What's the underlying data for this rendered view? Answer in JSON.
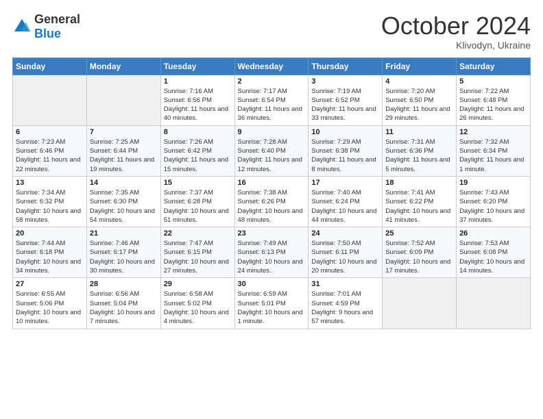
{
  "header": {
    "logo_general": "General",
    "logo_blue": "Blue",
    "month_title": "October 2024",
    "subtitle": "Klivodyn, Ukraine"
  },
  "weekdays": [
    "Sunday",
    "Monday",
    "Tuesday",
    "Wednesday",
    "Thursday",
    "Friday",
    "Saturday"
  ],
  "weeks": [
    [
      {
        "day": "",
        "sunrise": "",
        "sunset": "",
        "daylight": ""
      },
      {
        "day": "",
        "sunrise": "",
        "sunset": "",
        "daylight": ""
      },
      {
        "day": "1",
        "sunrise": "Sunrise: 7:16 AM",
        "sunset": "Sunset: 6:56 PM",
        "daylight": "Daylight: 11 hours and 40 minutes."
      },
      {
        "day": "2",
        "sunrise": "Sunrise: 7:17 AM",
        "sunset": "Sunset: 6:54 PM",
        "daylight": "Daylight: 11 hours and 36 minutes."
      },
      {
        "day": "3",
        "sunrise": "Sunrise: 7:19 AM",
        "sunset": "Sunset: 6:52 PM",
        "daylight": "Daylight: 11 hours and 33 minutes."
      },
      {
        "day": "4",
        "sunrise": "Sunrise: 7:20 AM",
        "sunset": "Sunset: 6:50 PM",
        "daylight": "Daylight: 11 hours and 29 minutes."
      },
      {
        "day": "5",
        "sunrise": "Sunrise: 7:22 AM",
        "sunset": "Sunset: 6:48 PM",
        "daylight": "Daylight: 11 hours and 26 minutes."
      }
    ],
    [
      {
        "day": "6",
        "sunrise": "Sunrise: 7:23 AM",
        "sunset": "Sunset: 6:46 PM",
        "daylight": "Daylight: 11 hours and 22 minutes."
      },
      {
        "day": "7",
        "sunrise": "Sunrise: 7:25 AM",
        "sunset": "Sunset: 6:44 PM",
        "daylight": "Daylight: 11 hours and 19 minutes."
      },
      {
        "day": "8",
        "sunrise": "Sunrise: 7:26 AM",
        "sunset": "Sunset: 6:42 PM",
        "daylight": "Daylight: 11 hours and 15 minutes."
      },
      {
        "day": "9",
        "sunrise": "Sunrise: 7:28 AM",
        "sunset": "Sunset: 6:40 PM",
        "daylight": "Daylight: 11 hours and 12 minutes."
      },
      {
        "day": "10",
        "sunrise": "Sunrise: 7:29 AM",
        "sunset": "Sunset: 6:38 PM",
        "daylight": "Daylight: 11 hours and 8 minutes."
      },
      {
        "day": "11",
        "sunrise": "Sunrise: 7:31 AM",
        "sunset": "Sunset: 6:36 PM",
        "daylight": "Daylight: 11 hours and 5 minutes."
      },
      {
        "day": "12",
        "sunrise": "Sunrise: 7:32 AM",
        "sunset": "Sunset: 6:34 PM",
        "daylight": "Daylight: 11 hours and 1 minute."
      }
    ],
    [
      {
        "day": "13",
        "sunrise": "Sunrise: 7:34 AM",
        "sunset": "Sunset: 6:32 PM",
        "daylight": "Daylight: 10 hours and 58 minutes."
      },
      {
        "day": "14",
        "sunrise": "Sunrise: 7:35 AM",
        "sunset": "Sunset: 6:30 PM",
        "daylight": "Daylight: 10 hours and 54 minutes."
      },
      {
        "day": "15",
        "sunrise": "Sunrise: 7:37 AM",
        "sunset": "Sunset: 6:28 PM",
        "daylight": "Daylight: 10 hours and 51 minutes."
      },
      {
        "day": "16",
        "sunrise": "Sunrise: 7:38 AM",
        "sunset": "Sunset: 6:26 PM",
        "daylight": "Daylight: 10 hours and 48 minutes."
      },
      {
        "day": "17",
        "sunrise": "Sunrise: 7:40 AM",
        "sunset": "Sunset: 6:24 PM",
        "daylight": "Daylight: 10 hours and 44 minutes."
      },
      {
        "day": "18",
        "sunrise": "Sunrise: 7:41 AM",
        "sunset": "Sunset: 6:22 PM",
        "daylight": "Daylight: 10 hours and 41 minutes."
      },
      {
        "day": "19",
        "sunrise": "Sunrise: 7:43 AM",
        "sunset": "Sunset: 6:20 PM",
        "daylight": "Daylight: 10 hours and 37 minutes."
      }
    ],
    [
      {
        "day": "20",
        "sunrise": "Sunrise: 7:44 AM",
        "sunset": "Sunset: 6:18 PM",
        "daylight": "Daylight: 10 hours and 34 minutes."
      },
      {
        "day": "21",
        "sunrise": "Sunrise: 7:46 AM",
        "sunset": "Sunset: 6:17 PM",
        "daylight": "Daylight: 10 hours and 30 minutes."
      },
      {
        "day": "22",
        "sunrise": "Sunrise: 7:47 AM",
        "sunset": "Sunset: 6:15 PM",
        "daylight": "Daylight: 10 hours and 27 minutes."
      },
      {
        "day": "23",
        "sunrise": "Sunrise: 7:49 AM",
        "sunset": "Sunset: 6:13 PM",
        "daylight": "Daylight: 10 hours and 24 minutes."
      },
      {
        "day": "24",
        "sunrise": "Sunrise: 7:50 AM",
        "sunset": "Sunset: 6:11 PM",
        "daylight": "Daylight: 10 hours and 20 minutes."
      },
      {
        "day": "25",
        "sunrise": "Sunrise: 7:52 AM",
        "sunset": "Sunset: 6:09 PM",
        "daylight": "Daylight: 10 hours and 17 minutes."
      },
      {
        "day": "26",
        "sunrise": "Sunrise: 7:53 AM",
        "sunset": "Sunset: 6:08 PM",
        "daylight": "Daylight: 10 hours and 14 minutes."
      }
    ],
    [
      {
        "day": "27",
        "sunrise": "Sunrise: 6:55 AM",
        "sunset": "Sunset: 5:06 PM",
        "daylight": "Daylight: 10 hours and 10 minutes."
      },
      {
        "day": "28",
        "sunrise": "Sunrise: 6:56 AM",
        "sunset": "Sunset: 5:04 PM",
        "daylight": "Daylight: 10 hours and 7 minutes."
      },
      {
        "day": "29",
        "sunrise": "Sunrise: 6:58 AM",
        "sunset": "Sunset: 5:02 PM",
        "daylight": "Daylight: 10 hours and 4 minutes."
      },
      {
        "day": "30",
        "sunrise": "Sunrise: 6:59 AM",
        "sunset": "Sunset: 5:01 PM",
        "daylight": "Daylight: 10 hours and 1 minute."
      },
      {
        "day": "31",
        "sunrise": "Sunrise: 7:01 AM",
        "sunset": "Sunset: 4:59 PM",
        "daylight": "Daylight: 9 hours and 57 minutes."
      },
      {
        "day": "",
        "sunrise": "",
        "sunset": "",
        "daylight": ""
      },
      {
        "day": "",
        "sunrise": "",
        "sunset": "",
        "daylight": ""
      }
    ]
  ]
}
